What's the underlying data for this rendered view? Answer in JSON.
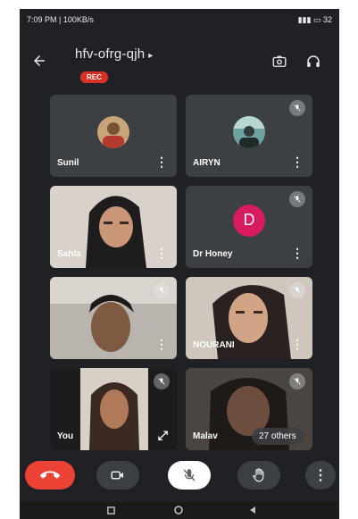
{
  "statusbar": {
    "time": "7:09 PM",
    "network_speed": "100KB/s",
    "battery": "32"
  },
  "meeting": {
    "code": "hfv-ofrg-qjh",
    "caret": "▸",
    "rec_label": "REC"
  },
  "icons": {
    "back": "arrow-left-icon",
    "switch_camera": "switch-camera-icon",
    "audio": "headphones-icon"
  },
  "participants": [
    {
      "name": "Sunil",
      "muted": false,
      "type": "avatar-photo"
    },
    {
      "name": "AIRYN",
      "muted": true,
      "type": "avatar-photo"
    },
    {
      "name": "Sahla",
      "muted": false,
      "type": "video"
    },
    {
      "name": "Dr Honey",
      "muted": true,
      "type": "avatar-letter",
      "initial": "D"
    },
    {
      "name": "",
      "muted": true,
      "type": "video"
    },
    {
      "name": "NOURANI",
      "muted": true,
      "type": "video"
    },
    {
      "name": "You",
      "muted": true,
      "type": "video"
    },
    {
      "name": "Malav",
      "muted": true,
      "type": "video"
    }
  ],
  "others_label": "27 others",
  "controls": {
    "end_call": "end-call-icon",
    "camera": "camera-icon",
    "mic": "mic-off-icon",
    "raise_hand": "raise-hand-icon",
    "more": "more-options-icon"
  },
  "colors": {
    "background": "#202124",
    "tile": "#3c4043",
    "end_call": "#ea4335",
    "rec": "#d93025",
    "avatar_d": "#d81b60"
  }
}
